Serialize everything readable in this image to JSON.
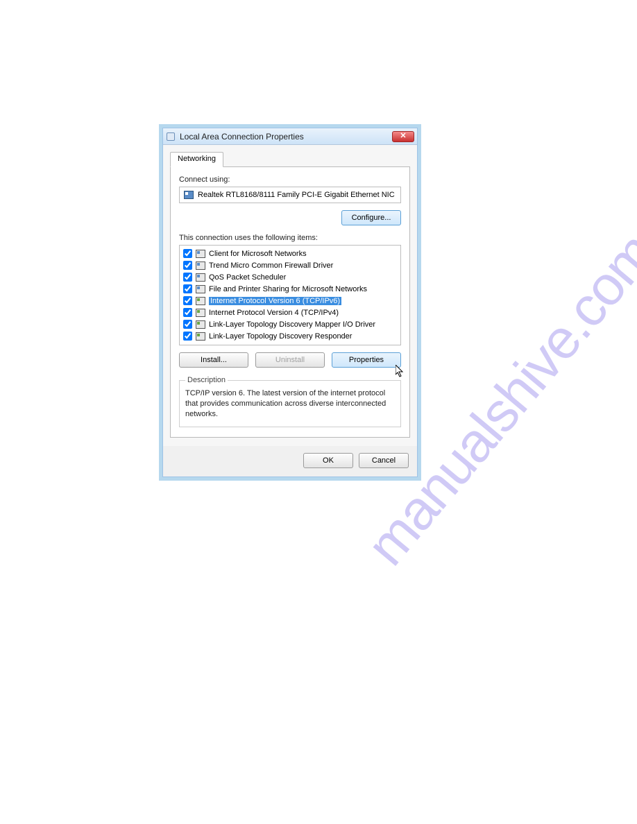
{
  "window": {
    "title": "Local Area Connection Properties",
    "close_icon_text": "✕"
  },
  "tab": {
    "networking": "Networking"
  },
  "connect_using_label": "Connect using:",
  "adapter_name": "Realtek RTL8168/8111 Family PCI-E Gigabit Ethernet NIC",
  "configure_label": "Configure...",
  "items_label": "This connection uses the following items:",
  "items": [
    {
      "checked": true,
      "icon": "pc",
      "label": "Client for Microsoft Networks"
    },
    {
      "checked": true,
      "icon": "pc",
      "label": "Trend Micro Common Firewall Driver"
    },
    {
      "checked": true,
      "icon": "pc",
      "label": "QoS Packet Scheduler"
    },
    {
      "checked": true,
      "icon": "pc",
      "label": "File and Printer Sharing for Microsoft Networks"
    },
    {
      "checked": true,
      "icon": "net",
      "label": "Internet Protocol Version 6 (TCP/IPv6)",
      "selected": true
    },
    {
      "checked": true,
      "icon": "net",
      "label": "Internet Protocol Version 4 (TCP/IPv4)"
    },
    {
      "checked": true,
      "icon": "net",
      "label": "Link-Layer Topology Discovery Mapper I/O Driver"
    },
    {
      "checked": true,
      "icon": "net",
      "label": "Link-Layer Topology Discovery Responder"
    }
  ],
  "buttons": {
    "install": "Install...",
    "uninstall": "Uninstall",
    "properties": "Properties",
    "ok": "OK",
    "cancel": "Cancel"
  },
  "description": {
    "legend": "Description",
    "text": "TCP/IP version 6. The latest version of the internet protocol that provides communication across diverse interconnected networks."
  },
  "watermark": "manualshive.com"
}
